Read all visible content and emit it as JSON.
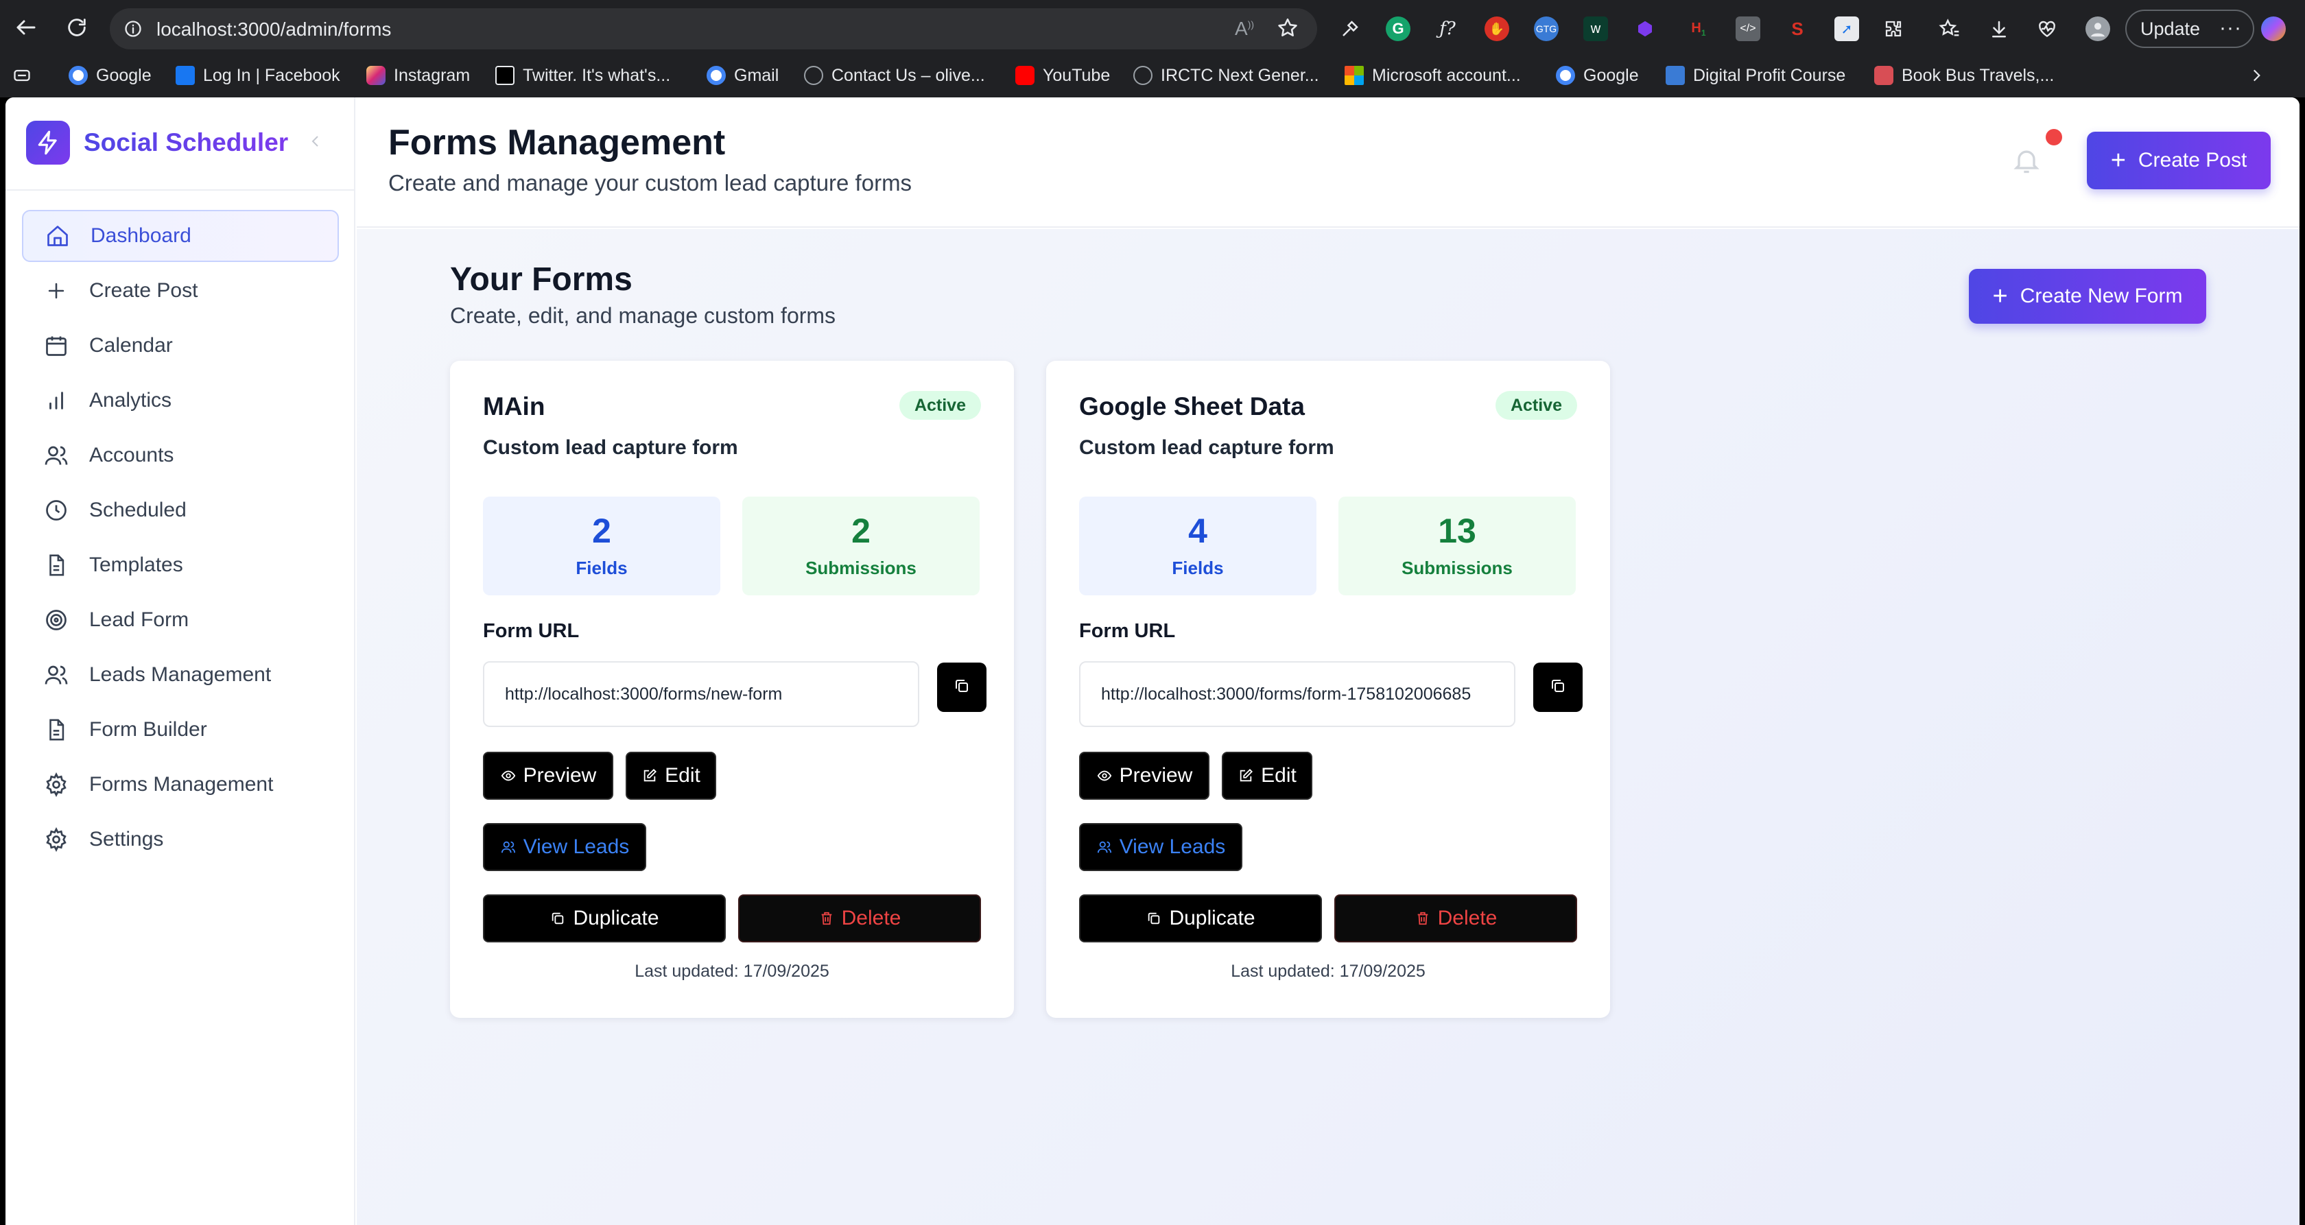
{
  "browser": {
    "url": "localhost:3000/admin/forms",
    "update_label": "Update",
    "bookmarks": [
      {
        "label": "Google",
        "color": "#4285f4"
      },
      {
        "label": "Log In | Facebook",
        "color": "#1877f2"
      },
      {
        "label": "Instagram",
        "color": "#e1306c"
      },
      {
        "label": "Twitter. It's what's...",
        "color": "#000000"
      },
      {
        "label": "Gmail",
        "color": "#4285f4"
      },
      {
        "label": "Contact Us – olive...",
        "color": "#9aa0a6"
      },
      {
        "label": "YouTube",
        "color": "#ff0000"
      },
      {
        "label": "IRCTC Next Gener...",
        "color": "#9aa0a6"
      },
      {
        "label": "Microsoft account...",
        "color": "#f25022"
      },
      {
        "label": "Google",
        "color": "#4285f4"
      },
      {
        "label": "Digital Profit Course",
        "color": "#3a7bd5"
      },
      {
        "label": "Book Bus Travels,...",
        "color": "#d84e55"
      }
    ]
  },
  "sidebar": {
    "brand": "Social Scheduler",
    "items": [
      {
        "label": "Dashboard",
        "icon": "home-icon",
        "active": true
      },
      {
        "label": "Create Post",
        "icon": "plus-icon"
      },
      {
        "label": "Calendar",
        "icon": "calendar-icon"
      },
      {
        "label": "Analytics",
        "icon": "bar-chart-icon"
      },
      {
        "label": "Accounts",
        "icon": "users-icon"
      },
      {
        "label": "Scheduled",
        "icon": "clock-icon"
      },
      {
        "label": "Templates",
        "icon": "file-text-icon"
      },
      {
        "label": "Lead Form",
        "icon": "target-icon"
      },
      {
        "label": "Leads Management",
        "icon": "users-icon"
      },
      {
        "label": "Form Builder",
        "icon": "file-text-icon"
      },
      {
        "label": "Forms Management",
        "icon": "gear-icon"
      },
      {
        "label": "Settings",
        "icon": "gear-icon"
      }
    ]
  },
  "header": {
    "title": "Forms Management",
    "subtitle": "Create and manage your custom lead capture forms",
    "create_post_label": "Create Post"
  },
  "main": {
    "title": "Your Forms",
    "subtitle": "Create, edit, and manage custom forms",
    "create_form_label": "Create New Form"
  },
  "forms": [
    {
      "name": "MAin",
      "status": "Active",
      "description": "Custom lead capture form",
      "fields": "2",
      "fields_label": "Fields",
      "submissions": "2",
      "submissions_label": "Submissions",
      "url_label": "Form URL",
      "url": "http://localhost:3000/forms/new-form",
      "preview_label": "Preview",
      "edit_label": "Edit",
      "view_leads_label": "View Leads",
      "duplicate_label": "Duplicate",
      "delete_label": "Delete",
      "last_updated": "Last updated: 17/09/2025"
    },
    {
      "name": "Google Sheet Data",
      "status": "Active",
      "description": "Custom lead capture form",
      "fields": "4",
      "fields_label": "Fields",
      "submissions": "13",
      "submissions_label": "Submissions",
      "url_label": "Form URL",
      "url": "http://localhost:3000/forms/form-1758102006685",
      "preview_label": "Preview",
      "edit_label": "Edit",
      "view_leads_label": "View Leads",
      "duplicate_label": "Duplicate",
      "delete_label": "Delete",
      "last_updated": "Last updated: 17/09/2025"
    }
  ]
}
